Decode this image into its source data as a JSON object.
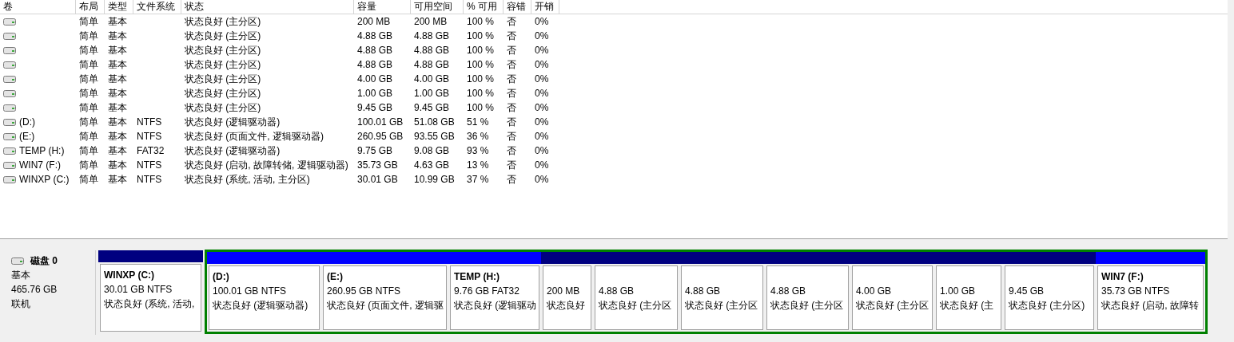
{
  "table": {
    "columns": [
      "卷",
      "布局",
      "类型",
      "文件系统",
      "状态",
      "容量",
      "可用空间",
      "% 可用",
      "容错",
      "开销"
    ],
    "rows": [
      {
        "layout": "简单",
        "type": "基本",
        "status": "状态良好 (主分区)",
        "capacity": "200 MB",
        "free": "200 MB",
        "pct": "100 %",
        "fault": "否",
        "overhead": "0%"
      },
      {
        "layout": "简单",
        "type": "基本",
        "status": "状态良好 (主分区)",
        "capacity": "4.88 GB",
        "free": "4.88 GB",
        "pct": "100 %",
        "fault": "否",
        "overhead": "0%"
      },
      {
        "layout": "简单",
        "type": "基本",
        "status": "状态良好 (主分区)",
        "capacity": "4.88 GB",
        "free": "4.88 GB",
        "pct": "100 %",
        "fault": "否",
        "overhead": "0%"
      },
      {
        "layout": "简单",
        "type": "基本",
        "status": "状态良好 (主分区)",
        "capacity": "4.88 GB",
        "free": "4.88 GB",
        "pct": "100 %",
        "fault": "否",
        "overhead": "0%"
      },
      {
        "layout": "简单",
        "type": "基本",
        "status": "状态良好 (主分区)",
        "capacity": "4.00 GB",
        "free": "4.00 GB",
        "pct": "100 %",
        "fault": "否",
        "overhead": "0%"
      },
      {
        "layout": "简单",
        "type": "基本",
        "status": "状态良好 (主分区)",
        "capacity": "1.00 GB",
        "free": "1.00 GB",
        "pct": "100 %",
        "fault": "否",
        "overhead": "0%"
      },
      {
        "layout": "简单",
        "type": "基本",
        "status": "状态良好 (主分区)",
        "capacity": "9.45 GB",
        "free": "9.45 GB",
        "pct": "100 %",
        "fault": "否",
        "overhead": "0%"
      },
      {
        "volume": "(D:)",
        "layout": "简单",
        "type": "基本",
        "fs": "NTFS",
        "status": "状态良好 (逻辑驱动器)",
        "capacity": "100.01 GB",
        "free": "51.08 GB",
        "pct": "51 %",
        "fault": "否",
        "overhead": "0%"
      },
      {
        "volume": "(E:)",
        "layout": "简单",
        "type": "基本",
        "fs": "NTFS",
        "status": "状态良好 (页面文件, 逻辑驱动器)",
        "capacity": "260.95 GB",
        "free": "93.55 GB",
        "pct": "36 %",
        "fault": "否",
        "overhead": "0%"
      },
      {
        "volume": "TEMP (H:)",
        "layout": "简单",
        "type": "基本",
        "fs": "FAT32",
        "status": "状态良好 (逻辑驱动器)",
        "capacity": "9.75 GB",
        "free": "9.08 GB",
        "pct": "93 %",
        "fault": "否",
        "overhead": "0%"
      },
      {
        "volume": "WIN7 (F:)",
        "layout": "简单",
        "type": "基本",
        "fs": "NTFS",
        "status": "状态良好 (启动, 故障转储, 逻辑驱动器)",
        "capacity": "35.73 GB",
        "free": "4.63 GB",
        "pct": "13 %",
        "fault": "否",
        "overhead": "0%"
      },
      {
        "volume": "WINXP (C:)",
        "layout": "简单",
        "type": "基本",
        "fs": "NTFS",
        "status": "状态良好 (系统, 活动, 主分区)",
        "capacity": "30.01 GB",
        "free": "10.99 GB",
        "pct": "37 %",
        "fault": "否",
        "overhead": "0%"
      }
    ]
  },
  "disk": {
    "name": "磁盘 0",
    "type": "基本",
    "size": "465.76 GB",
    "state": "联机",
    "partitions": [
      {
        "kind": "primary",
        "label": "WINXP  (C:)",
        "size": "30.01 GB NTFS",
        "status": "状态良好 (系统, 活动,"
      },
      {
        "kind": "extended",
        "children": [
          {
            "kind": "logical",
            "label": "(D:)",
            "size": "100.01 GB NTFS",
            "status": "状态良好 (逻辑驱动器)"
          },
          {
            "kind": "logical",
            "label": "(E:)",
            "size": "260.95 GB NTFS",
            "status": "状态良好 (页面文件, 逻辑驱"
          },
          {
            "kind": "logical",
            "label": "TEMP  (H:)",
            "size": "9.76 GB FAT32",
            "status": "状态良好 (逻辑驱动"
          },
          {
            "kind": "primary",
            "size": "200 MB",
            "status": "状态良好"
          },
          {
            "kind": "primary",
            "size": "4.88 GB",
            "status": "状态良好 (主分区"
          },
          {
            "kind": "primary",
            "size": "4.88 GB",
            "status": "状态良好 (主分区"
          },
          {
            "kind": "primary",
            "size": "4.88 GB",
            "status": "状态良好 (主分区"
          },
          {
            "kind": "primary",
            "size": "4.00 GB",
            "status": "状态良好 (主分区"
          },
          {
            "kind": "primary",
            "size": "1.00 GB",
            "status": "状态良好 (主"
          },
          {
            "kind": "primary",
            "size": "9.45 GB",
            "status": "状态良好 (主分区)"
          },
          {
            "kind": "logical",
            "label": "WIN7  (F:)",
            "size": "35.73 GB NTFS",
            "status": "状态良好 (启动, 故障转"
          }
        ]
      }
    ]
  }
}
